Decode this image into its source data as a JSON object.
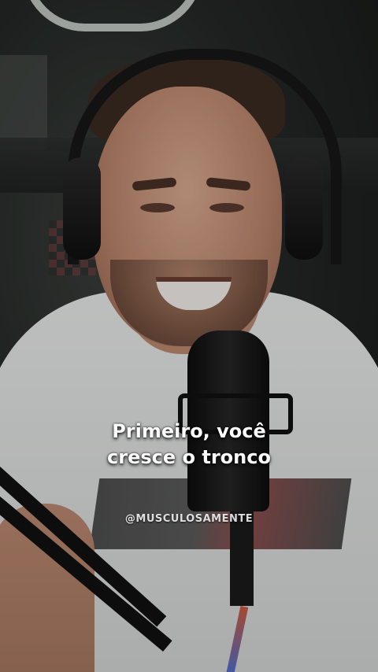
{
  "caption": {
    "line1": "Primeiro, você",
    "line2": "cresce o tronco"
  },
  "watermark": {
    "handle": "@MUSCULOSAMENTE"
  },
  "colors": {
    "caption_text": "#ffffff",
    "shirt": "#e7e9e8",
    "background": "#1b1d1c"
  }
}
